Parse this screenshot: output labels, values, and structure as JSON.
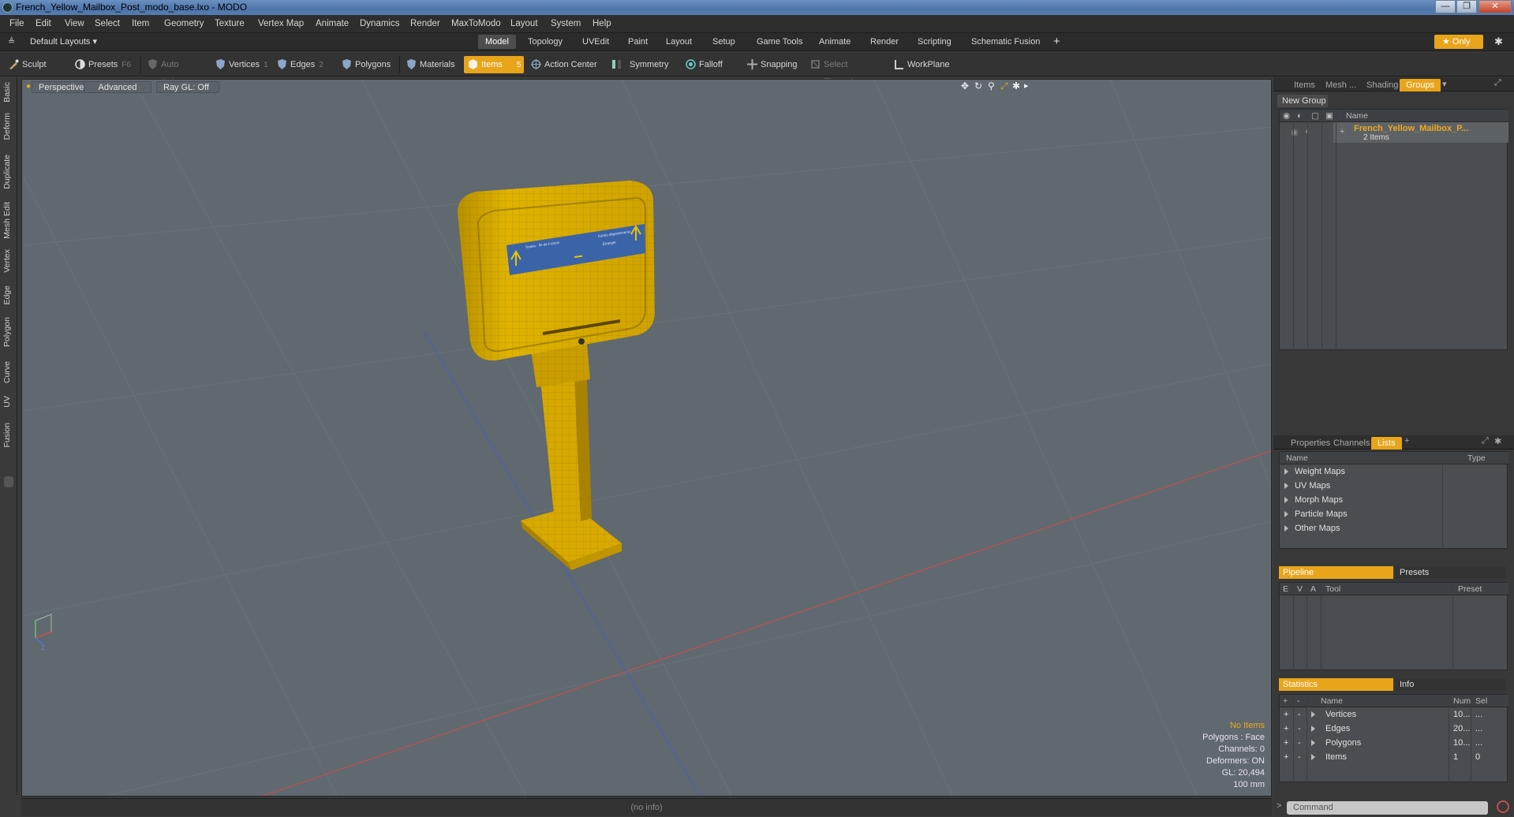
{
  "window": {
    "title": "French_Yellow_Mailbox_Post_modo_base.lxo - MODO",
    "controls": [
      "—",
      "❐",
      "✕"
    ]
  },
  "menu": [
    "File",
    "Edit",
    "View",
    "Select",
    "Item",
    "Geometry",
    "Texture",
    "Vertex Map",
    "Animate",
    "Dynamics",
    "Render",
    "MaxToModo",
    "Layout",
    "System",
    "Help"
  ],
  "layoutbar": {
    "layout_menu": "Default Layouts ▾",
    "tabs": [
      "Model",
      "Topology",
      "UVEdit",
      "Paint",
      "Layout",
      "Setup",
      "Game Tools",
      "Animate",
      "Render",
      "Scripting",
      "Schematic Fusion"
    ],
    "active_tab": "Model",
    "add": "+",
    "only": "★ Only",
    "gear": "✱"
  },
  "toolbar": {
    "sculpt": "Sculpt",
    "presets": "Presets",
    "presets_key": "F6",
    "auto_select": "Auto Select",
    "vertices": "Vertices",
    "vertices_key": "1",
    "edges": "Edges",
    "edges_key": "2",
    "polygons": "Polygons",
    "materials": "Materials",
    "items": "Items",
    "items_key": "5",
    "action_center": "Action Center",
    "symmetry": "Symmetry",
    "falloff": "Falloff",
    "snapping": "Snapping",
    "select_through": "Select Through",
    "workplane": "WorkPlane"
  },
  "left_tabs": [
    "Basic",
    "Deform",
    "Duplicate",
    "Mesh Edit",
    "Vertex",
    "Edge",
    "Polygon",
    "Curve",
    "UV",
    "Fusion"
  ],
  "viewport": {
    "view": "Perspective",
    "advanced": "Advanced",
    "raygl": "Ray GL: Off",
    "sign_lines": [
      "Toutes · Île de France",
      "Autres départements",
      "Étranger"
    ],
    "info": {
      "no_items": "No Items",
      "polygons": "Polygons : Face",
      "channels": "Channels: 0",
      "deformers": "Deformers: ON",
      "gl": "GL: 20,494",
      "scale": "100 mm"
    },
    "axis_labels": {
      "y": "Y",
      "x": "X",
      "z": "Z"
    }
  },
  "status": "(no info)",
  "groups_panel": {
    "tabs": [
      "Items",
      "Mesh ...",
      "Shading",
      "Groups"
    ],
    "active_tab": "Groups",
    "new_group": "New Group",
    "name_header": "Name",
    "group_name": "French_Yellow_Mailbox_P...",
    "group_count": "2 Items"
  },
  "lists_panel": {
    "tabs": [
      "Properties",
      "Channels",
      "Lists"
    ],
    "active_tab": "Lists",
    "add": "+",
    "headers": {
      "name": "Name",
      "type": "Type"
    },
    "rows": [
      "Weight Maps",
      "UV Maps",
      "Morph Maps",
      "Particle Maps",
      "Other Maps"
    ]
  },
  "pipeline_panel": {
    "tabs": [
      "Pipeline",
      "Presets"
    ],
    "headers": {
      "e": "E",
      "v": "V",
      "a": "A",
      "tool": "Tool",
      "preset": "Preset"
    }
  },
  "stats_panel": {
    "tabs": [
      "Statistics",
      "Info"
    ],
    "headers": {
      "plus": "+",
      "minus": "-",
      "name": "Name",
      "num": "Num",
      "sel": "Sel"
    },
    "rows": [
      {
        "name": "Vertices",
        "num": "10...",
        "sel": "..."
      },
      {
        "name": "Edges",
        "num": "20...",
        "sel": "..."
      },
      {
        "name": "Polygons",
        "num": "10...",
        "sel": "..."
      },
      {
        "name": "Items",
        "num": "1",
        "sel": "0"
      }
    ]
  },
  "command": {
    "prompt": ">",
    "placeholder": "Command"
  },
  "colors": {
    "accent": "#e8a41a",
    "mailbox": "#e3b200",
    "sign": "#3b64a8"
  }
}
